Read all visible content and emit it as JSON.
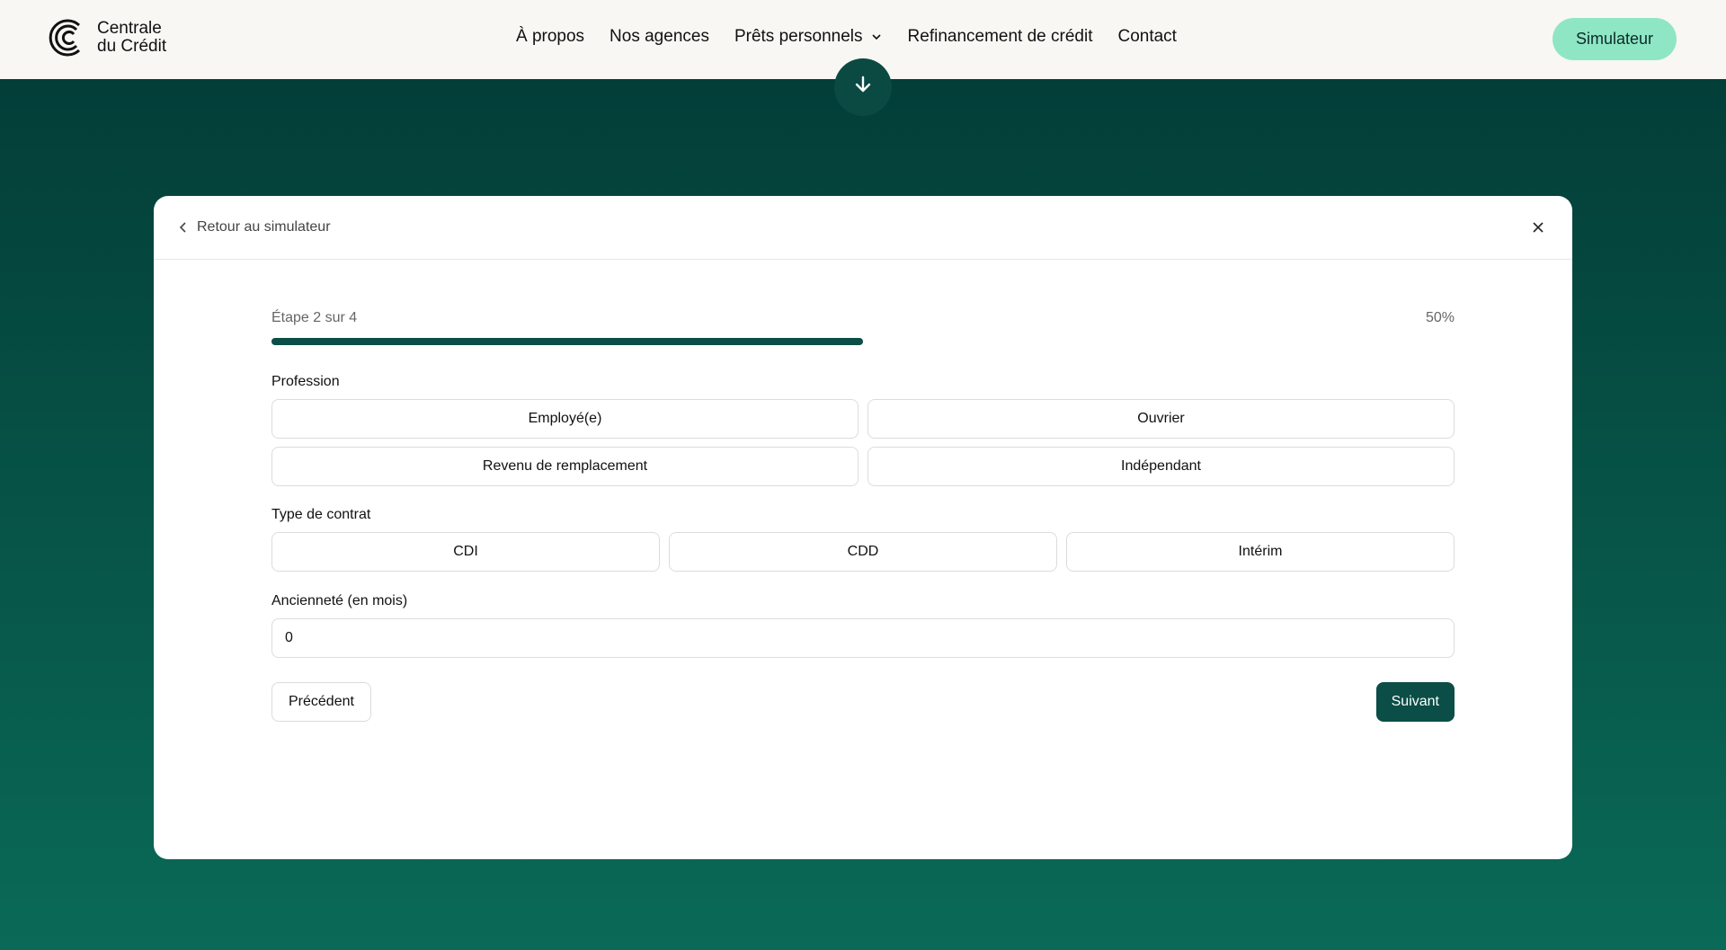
{
  "header": {
    "logo": {
      "line1": "Centrale",
      "line2": "du Crédit"
    },
    "nav": [
      {
        "label": "À propos"
      },
      {
        "label": "Nos agences"
      },
      {
        "label": "Prêts personnels",
        "has_dropdown": true
      },
      {
        "label": "Refinancement de crédit"
      },
      {
        "label": "Contact"
      }
    ],
    "cta_label": "Simulateur"
  },
  "modal": {
    "back_label": "Retour au simulateur",
    "step_label": "Étape 2 sur 4",
    "progress_percent_label": "50%",
    "progress_value": 0.5,
    "profession": {
      "label": "Profession",
      "options": [
        "Employé(e)",
        "Ouvrier",
        "Revenu de remplacement",
        "Indépendant"
      ]
    },
    "contract": {
      "label": "Type de contrat",
      "options": [
        "CDI",
        "CDD",
        "Intérim"
      ]
    },
    "seniority": {
      "label": "Ancienneté (en mois)",
      "value": "0"
    },
    "prev_label": "Précédent",
    "next_label": "Suivant"
  },
  "colors": {
    "accent": "#0b4d47",
    "cta": "#8fe6c4",
    "header_bg": "#f8f7f3",
    "page_bg_top": "#023a36",
    "page_bg_bottom": "#0a6a57"
  }
}
